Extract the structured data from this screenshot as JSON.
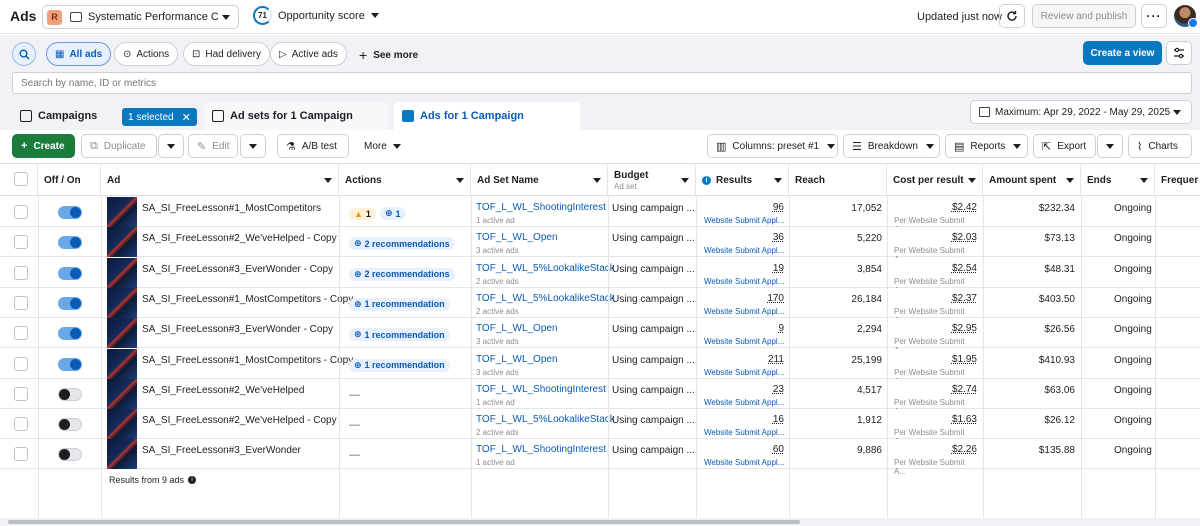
{
  "topbar": {
    "title": "Ads",
    "account_badge": "R",
    "account_name": "Systematic Performance Co...",
    "opportunity_score": "71",
    "opportunity_label": "Opportunity score",
    "updated": "Updated just now",
    "review_publish": "Review and publish",
    "more": "···"
  },
  "filters": {
    "items": [
      {
        "label": "All ads",
        "icon": "grid-icon",
        "active": true
      },
      {
        "label": "Actions",
        "icon": "arrow-up-circle-icon"
      },
      {
        "label": "Had delivery",
        "icon": "inbox-icon"
      },
      {
        "label": "Active ads",
        "icon": "send-icon"
      }
    ],
    "see_more": "See more",
    "create_view": "Create a view"
  },
  "search": {
    "placeholder": "Search by name, ID or metrics"
  },
  "tabs": {
    "campaigns": "Campaigns",
    "selected": "1 selected",
    "adsets": "Ad sets for 1 Campaign",
    "ads": "Ads for 1 Campaign"
  },
  "date_range": "Maximum: Apr 29, 2022 - May 29, 2025",
  "toolbar": {
    "create": "Create",
    "duplicate": "Duplicate",
    "edit": "Edit",
    "ab_test": "A/B test",
    "more": "More",
    "columns": "Columns: preset #1",
    "breakdown": "Breakdown",
    "reports": "Reports",
    "export": "Export",
    "charts": "Charts"
  },
  "columns": {
    "off_on": "Off / On",
    "ad": "Ad",
    "actions": "Actions",
    "ad_set_name": "Ad Set Name",
    "budget": "Budget",
    "budget_sub": "Ad set",
    "results": "Results",
    "reach": "Reach",
    "cost_per_result": "Cost per result",
    "amount_spent": "Amount spent",
    "ends": "Ends",
    "frequency": "Frequer"
  },
  "rows": [
    {
      "on": true,
      "ad": "SA_SI_FreeLesson#1_MostCompetitors",
      "warn": "1",
      "rec": "1",
      "adset": "TOF_L_WL_ShootingInterest",
      "adset_sub": "1 active ad",
      "budget": "Using campaign ...",
      "results": "96",
      "results_sub": "Website Submit Appl...",
      "reach": "17,052",
      "cpr": "$2.42",
      "cpr_sub": "Per Website Submit A...",
      "spent": "$232.34",
      "ends": "Ongoing"
    },
    {
      "on": true,
      "ad": "SA_SI_FreeLesson#2_We'veHelped - Copy",
      "rec": "2 recommendations",
      "adset": "TOF_L_WL_Open",
      "adset_sub": "3 active ads",
      "budget": "Using campaign ...",
      "results": "36",
      "results_sub": "Website Submit Appl...",
      "reach": "5,220",
      "cpr": "$2.03",
      "cpr_sub": "Per Website Submit A...",
      "spent": "$73.13",
      "ends": "Ongoing"
    },
    {
      "on": true,
      "ad": "SA_SI_FreeLesson#3_EverWonder - Copy",
      "rec": "2 recommendations",
      "adset": "TOF_L_WL_5%LookalikeStack",
      "adset_sub": "2 active ads",
      "budget": "Using campaign ...",
      "results": "19",
      "results_sub": "Website Submit Appl...",
      "reach": "3,854",
      "cpr": "$2.54",
      "cpr_sub": "Per Website Submit A...",
      "spent": "$48.31",
      "ends": "Ongoing"
    },
    {
      "on": true,
      "ad": "SA_SI_FreeLesson#1_MostCompetitors - Copy",
      "rec": "1 recommendation",
      "adset": "TOF_L_WL_5%LookalikeStack",
      "adset_sub": "2 active ads",
      "budget": "Using campaign ...",
      "results": "170",
      "results_sub": "Website Submit Appl...",
      "reach": "26,184",
      "cpr": "$2.37",
      "cpr_sub": "Per Website Submit A...",
      "spent": "$403.50",
      "ends": "Ongoing"
    },
    {
      "on": true,
      "ad": "SA_SI_FreeLesson#3_EverWonder - Copy",
      "rec": "1 recommendation",
      "adset": "TOF_L_WL_Open",
      "adset_sub": "3 active ads",
      "budget": "Using campaign ...",
      "results": "9",
      "results_sub": "Website Submit Appl...",
      "reach": "2,294",
      "cpr": "$2.95",
      "cpr_sub": "Per Website Submit A...",
      "spent": "$26.56",
      "ends": "Ongoing"
    },
    {
      "on": true,
      "ad": "SA_SI_FreeLesson#1_MostCompetitors - Copy",
      "rec": "1 recommendation",
      "adset": "TOF_L_WL_Open",
      "adset_sub": "3 active ads",
      "budget": "Using campaign ...",
      "results": "211",
      "results_sub": "Website Submit Appl...",
      "reach": "25,199",
      "cpr": "$1.95",
      "cpr_sub": "Per Website Submit A...",
      "spent": "$410.93",
      "ends": "Ongoing"
    },
    {
      "on": false,
      "ad": "SA_SI_FreeLesson#2_We'veHelped",
      "dash": "—",
      "adset": "TOF_L_WL_ShootingInterest",
      "adset_sub": "1 active ad",
      "budget": "Using campaign ...",
      "results": "23",
      "results_sub": "Website Submit Appl...",
      "reach": "4,517",
      "cpr": "$2.74",
      "cpr_sub": "Per Website Submit A...",
      "spent": "$63.06",
      "ends": "Ongoing"
    },
    {
      "on": false,
      "ad": "SA_SI_FreeLesson#2_We'veHelped - Copy",
      "dash": "—",
      "adset": "TOF_L_WL_5%LookalikeStack",
      "adset_sub": "2 active ads",
      "budget": "Using campaign ...",
      "results": "16",
      "results_sub": "Website Submit Appl...",
      "reach": "1,912",
      "cpr": "$1.63",
      "cpr_sub": "Per Website Submit A...",
      "spent": "$26.12",
      "ends": "Ongoing"
    },
    {
      "on": false,
      "ad": "SA_SI_FreeLesson#3_EverWonder",
      "dash": "—",
      "adset": "TOF_L_WL_ShootingInterest",
      "adset_sub": "1 active ad",
      "budget": "Using campaign ...",
      "results": "60",
      "results_sub": "Website Submit Appl...",
      "reach": "9,886",
      "cpr": "$2.26",
      "cpr_sub": "Per Website Submit A...",
      "spent": "$135.88",
      "ends": "Ongoing"
    }
  ],
  "footer": {
    "results_from": "Results from 9 ads"
  },
  "colors": {
    "accent": "#0a78be",
    "create_green": "#1b7c3c",
    "link": "#0a5bb5"
  }
}
